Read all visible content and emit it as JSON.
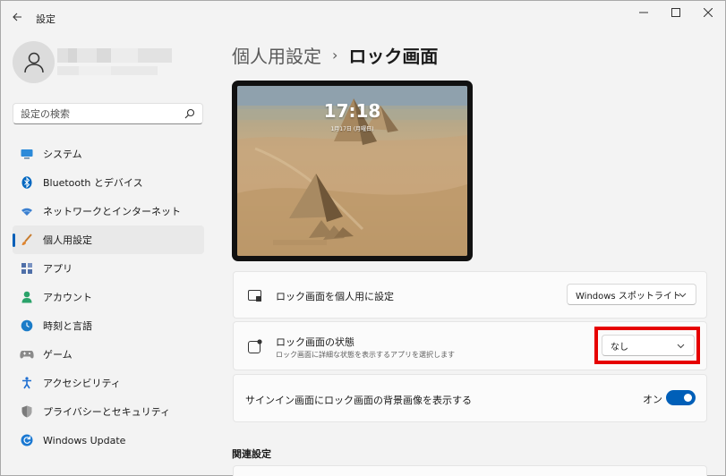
{
  "app": {
    "title": "設定"
  },
  "window_controls": {
    "minimize_icon": "minimize-icon",
    "maximize_icon": "maximize-icon",
    "close_icon": "close-icon"
  },
  "search": {
    "placeholder": "設定の検索"
  },
  "sidebar": {
    "items": [
      {
        "label": "システム",
        "icon": "system-icon",
        "color": "#0078d4"
      },
      {
        "label": "Bluetooth とデバイス",
        "icon": "bluetooth-icon",
        "color": "#0067c0"
      },
      {
        "label": "ネットワークとインターネット",
        "icon": "network-icon",
        "color": "#3b7fcf"
      },
      {
        "label": "個人用設定",
        "icon": "personalization-icon",
        "color": "#e0852f",
        "selected": true
      },
      {
        "label": "アプリ",
        "icon": "apps-icon",
        "color": "#4f6fa8"
      },
      {
        "label": "アカウント",
        "icon": "account-icon",
        "color": "#2ba36a"
      },
      {
        "label": "時刻と言語",
        "icon": "time-language-icon",
        "color": "#1b7cc8"
      },
      {
        "label": "ゲーム",
        "icon": "gaming-icon",
        "color": "#7a7a7a"
      },
      {
        "label": "アクセシビリティ",
        "icon": "accessibility-icon",
        "color": "#1f6fd1"
      },
      {
        "label": "プライバシーとセキュリティ",
        "icon": "privacy-shield-icon",
        "color": "#6b6b6b"
      },
      {
        "label": "Windows Update",
        "icon": "windows-update-icon",
        "color": "#1a78d2"
      }
    ]
  },
  "breadcrumb": {
    "parent": "個人用設定",
    "separator": "›",
    "current": "ロック画面"
  },
  "preview": {
    "time": "17:18",
    "date": "1月17日 (月曜日)"
  },
  "settings": {
    "personalize": {
      "title": "ロック画面を個人用に設定",
      "value": "Windows スポットライト"
    },
    "status": {
      "title": "ロック画面の状態",
      "description": "ロック画面に詳細な状態を表示するアプリを選択します",
      "value": "なし"
    },
    "signin_bg": {
      "title": "サインイン画面にロック画面の背景画像を表示する",
      "toggle_label": "オン",
      "enabled": true
    }
  },
  "related": {
    "heading": "関連設定"
  },
  "colors": {
    "accent": "#005fb8",
    "highlight": "#e60000"
  }
}
